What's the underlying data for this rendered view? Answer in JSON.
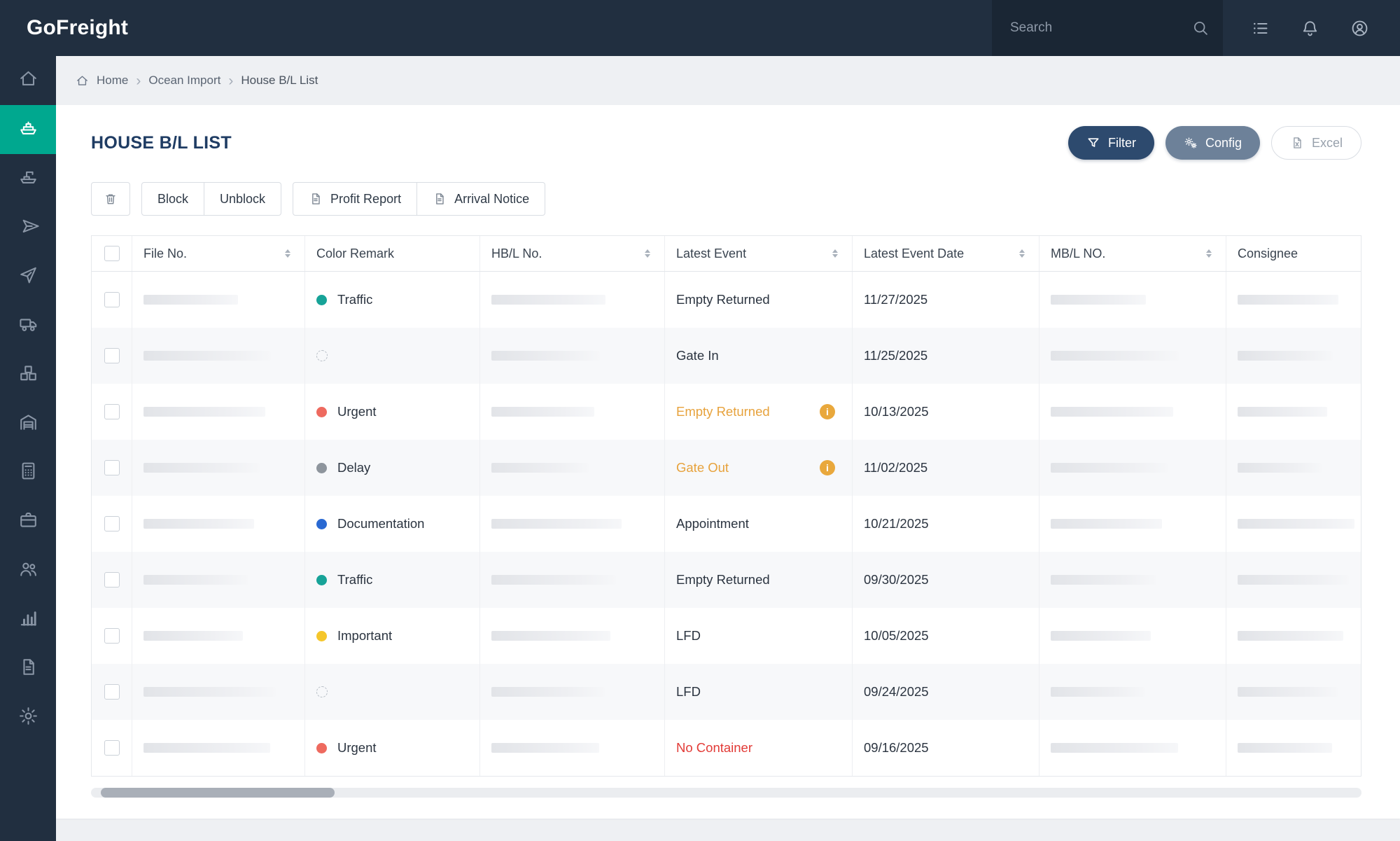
{
  "brand": "GoFreight",
  "topbar": {
    "search_placeholder": "Search",
    "icons": [
      {
        "id": "tasks",
        "icon": "list"
      },
      {
        "id": "notifications",
        "icon": "bell"
      },
      {
        "id": "account",
        "icon": "account"
      }
    ]
  },
  "sidebar": {
    "items": [
      {
        "id": "home",
        "icon": "home",
        "active": false
      },
      {
        "id": "ocean-import",
        "icon": "ship-import",
        "active": true
      },
      {
        "id": "ocean-export",
        "icon": "ship-export",
        "active": false
      },
      {
        "id": "air-import",
        "icon": "plane-import",
        "active": false
      },
      {
        "id": "air-export",
        "icon": "plane-export",
        "active": false
      },
      {
        "id": "trucking",
        "icon": "truck",
        "active": false
      },
      {
        "id": "cargo",
        "icon": "boxes",
        "active": false
      },
      {
        "id": "warehouse",
        "icon": "warehouse",
        "active": false
      },
      {
        "id": "accounting",
        "icon": "calculator",
        "active": false
      },
      {
        "id": "jobs",
        "icon": "briefcase",
        "active": false
      },
      {
        "id": "customers",
        "icon": "people",
        "active": false
      },
      {
        "id": "analytics",
        "icon": "bar-chart",
        "active": false
      },
      {
        "id": "documents",
        "icon": "document",
        "active": false
      },
      {
        "id": "settings",
        "icon": "gear",
        "active": false
      }
    ]
  },
  "breadcrumb": {
    "items": [
      "Home",
      "Ocean Import",
      "House B/L List"
    ]
  },
  "page_title": "HOUSE B/L LIST",
  "header_actions": {
    "filter": "Filter",
    "config": "Config",
    "excel": "Excel"
  },
  "toolbar": {
    "block": "Block",
    "unblock": "Unblock",
    "profit_report": "Profit Report",
    "arrival_notice": "Arrival Notice"
  },
  "table": {
    "columns": [
      {
        "label": "File No.",
        "sortable": true
      },
      {
        "label": "Color Remark",
        "sortable": false
      },
      {
        "label": "HB/L No.",
        "sortable": true
      },
      {
        "label": "Latest Event",
        "sortable": true
      },
      {
        "label": "Latest Event Date",
        "sortable": true
      },
      {
        "label": "MB/L NO.",
        "sortable": true
      },
      {
        "label": "Consignee",
        "sortable": false
      }
    ],
    "rows": [
      {
        "color_remark": "Traffic",
        "dot": "teal",
        "latest_event": "Empty Returned",
        "event_style": "default",
        "info": false,
        "latest_event_date": "11/27/2025"
      },
      {
        "color_remark": "",
        "dot": "none",
        "latest_event": "Gate In",
        "event_style": "default",
        "info": false,
        "latest_event_date": "11/25/2025"
      },
      {
        "color_remark": "Urgent",
        "dot": "red",
        "latest_event": "Empty Returned",
        "event_style": "warning",
        "info": true,
        "latest_event_date": "10/13/2025"
      },
      {
        "color_remark": "Delay",
        "dot": "gray",
        "latest_event": "Gate Out",
        "event_style": "warning",
        "info": true,
        "latest_event_date": "11/02/2025"
      },
      {
        "color_remark": "Documentation",
        "dot": "blue",
        "latest_event": "Appointment",
        "event_style": "default",
        "info": false,
        "latest_event_date": "10/21/2025"
      },
      {
        "color_remark": "Traffic",
        "dot": "teal",
        "latest_event": "Empty Returned",
        "event_style": "default",
        "info": false,
        "latest_event_date": "09/30/2025"
      },
      {
        "color_remark": "Important",
        "dot": "yellow",
        "latest_event": "LFD",
        "event_style": "default",
        "info": false,
        "latest_event_date": "10/05/2025"
      },
      {
        "color_remark": "",
        "dot": "none",
        "latest_event": "LFD",
        "event_style": "default",
        "info": false,
        "latest_event_date": "09/24/2025"
      },
      {
        "color_remark": "Urgent",
        "dot": "red",
        "latest_event": "No Container",
        "event_style": "danger",
        "info": false,
        "latest_event_date": "09/16/2025"
      }
    ]
  },
  "colors": {
    "topbar_bg": "#212F40",
    "active_teal": "#00A88F",
    "filter_button": "#2D4A6E",
    "config_button": "#6D8199",
    "warning_text": "#E7A23C",
    "danger_text": "#E23A36",
    "dot_teal": "#17A398",
    "dot_red": "#EE6A5F",
    "dot_gray": "#8E959D",
    "dot_blue": "#2A69D2",
    "dot_yellow": "#F5C62B"
  }
}
